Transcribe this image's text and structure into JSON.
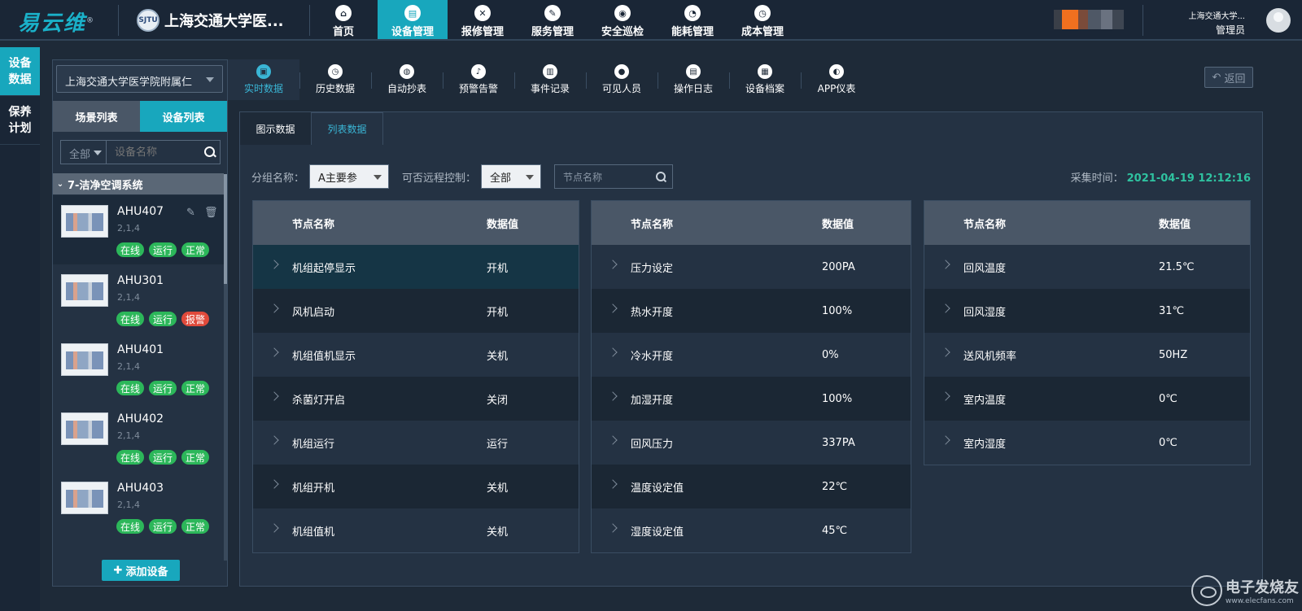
{
  "topbar": {
    "logo": "易云维",
    "org_title": "上海交通大学医...",
    "nav": [
      {
        "label": "首页",
        "icon": "home-icon",
        "glyph": "⌂"
      },
      {
        "label": "设备管理",
        "icon": "device-icon",
        "glyph": "▤"
      },
      {
        "label": "报修管理",
        "icon": "tools-icon",
        "glyph": "✕"
      },
      {
        "label": "服务管理",
        "icon": "edit-icon",
        "glyph": "✎"
      },
      {
        "label": "安全巡检",
        "icon": "location-icon",
        "glyph": "◉"
      },
      {
        "label": "能耗管理",
        "icon": "pie-chart-icon",
        "glyph": "◔"
      },
      {
        "label": "成本管理",
        "icon": "clock-icon",
        "glyph": "◷"
      }
    ],
    "active_nav": "设备管理",
    "user": {
      "org": "上海交通大学...",
      "role": "管理员"
    }
  },
  "sidenav": [
    {
      "label": "设备数据",
      "active": true
    },
    {
      "label": "保养计划",
      "active": false
    }
  ],
  "device_panel": {
    "org_select": "上海交通大学医学院附属仁",
    "tabs": [
      {
        "label": "场景列表",
        "active": false
      },
      {
        "label": "设备列表",
        "active": true
      }
    ],
    "filter_scope": "全部",
    "search_placeholder": "设备名称",
    "group": "7-洁净空调系统",
    "devices": [
      {
        "name": "AHU407",
        "sub": "2,1,4",
        "tags": [
          {
            "label": "在线",
            "color": "green"
          },
          {
            "label": "运行",
            "color": "green"
          },
          {
            "label": "正常",
            "color": "green"
          }
        ],
        "selected": true
      },
      {
        "name": "AHU301",
        "sub": "2,1,4",
        "tags": [
          {
            "label": "在线",
            "color": "green"
          },
          {
            "label": "运行",
            "color": "green"
          },
          {
            "label": "报警",
            "color": "red"
          }
        ],
        "selected": false
      },
      {
        "name": "AHU401",
        "sub": "2,1,4",
        "tags": [
          {
            "label": "在线",
            "color": "green"
          },
          {
            "label": "运行",
            "color": "green"
          },
          {
            "label": "正常",
            "color": "green"
          }
        ],
        "selected": false
      },
      {
        "name": "AHU402",
        "sub": "2,1,4",
        "tags": [
          {
            "label": "在线",
            "color": "green"
          },
          {
            "label": "运行",
            "color": "green"
          },
          {
            "label": "正常",
            "color": "green"
          }
        ],
        "selected": false
      },
      {
        "name": "AHU403",
        "sub": "2,1,4",
        "tags": [
          {
            "label": "在线",
            "color": "green"
          },
          {
            "label": "运行",
            "color": "green"
          },
          {
            "label": "正常",
            "color": "green"
          }
        ],
        "selected": false
      }
    ],
    "add_button": "添加设备"
  },
  "subnav": [
    {
      "label": "实时数据",
      "icon": "realtime-icon",
      "glyph": "▣",
      "active": true
    },
    {
      "label": "历史数据",
      "icon": "history-icon",
      "glyph": "◷",
      "active": false
    },
    {
      "label": "自动抄表",
      "icon": "meter-icon",
      "glyph": "◍",
      "active": false
    },
    {
      "label": "预警告警",
      "icon": "bell-icon",
      "glyph": "♪",
      "active": false
    },
    {
      "label": "事件记录",
      "icon": "record-icon",
      "glyph": "▥",
      "active": false
    },
    {
      "label": "可见人员",
      "icon": "person-icon",
      "glyph": "●",
      "active": false
    },
    {
      "label": "操作日志",
      "icon": "log-icon",
      "glyph": "▤",
      "active": false
    },
    {
      "label": "设备档案",
      "icon": "archive-icon",
      "glyph": "▦",
      "active": false
    },
    {
      "label": "APP仪表",
      "icon": "gauge-icon",
      "glyph": "◐",
      "active": false
    }
  ],
  "back_label": "返回",
  "view_tabs": [
    {
      "label": "图示数据",
      "active": false
    },
    {
      "label": "列表数据",
      "active": true
    }
  ],
  "filters": {
    "group_label": "分组名称：",
    "group_value": "A主要参",
    "remote_label": "可否远程控制：",
    "remote_value": "全部",
    "node_placeholder": "节点名称"
  },
  "collect": {
    "label": "采集时间：",
    "time": "2021-04-19 12:12:16"
  },
  "tables": [
    {
      "headers": [
        "节点名称",
        "数据值"
      ],
      "rows": [
        [
          "机组起停显示",
          "开机"
        ],
        [
          "风机启动",
          "开机"
        ],
        [
          "机组值机显示",
          "关机"
        ],
        [
          "杀菌灯开启",
          "关闭"
        ],
        [
          "机组运行",
          "运行"
        ],
        [
          "机组开机",
          "关机"
        ],
        [
          "机组值机",
          "关机"
        ]
      ]
    },
    {
      "headers": [
        "节点名称",
        "数据值"
      ],
      "rows": [
        [
          "压力设定",
          "200PA"
        ],
        [
          "热水开度",
          "100%"
        ],
        [
          "冷水开度",
          "0%"
        ],
        [
          "加湿开度",
          "100%"
        ],
        [
          "回风压力",
          "337PA"
        ],
        [
          "温度设定值",
          "22℃"
        ],
        [
          "湿度设定值",
          "45℃"
        ]
      ]
    },
    {
      "headers": [
        "节点名称",
        "数据值"
      ],
      "rows": [
        [
          "回风温度",
          "21.5℃"
        ],
        [
          "回风湿度",
          "31℃"
        ],
        [
          "送风机频率",
          "50HZ"
        ],
        [
          "室内温度",
          "0℃"
        ],
        [
          "室内湿度",
          "0℃"
        ]
      ]
    }
  ],
  "watermark": {
    "title": "电子发烧友",
    "url": "www.elecfans.com"
  }
}
